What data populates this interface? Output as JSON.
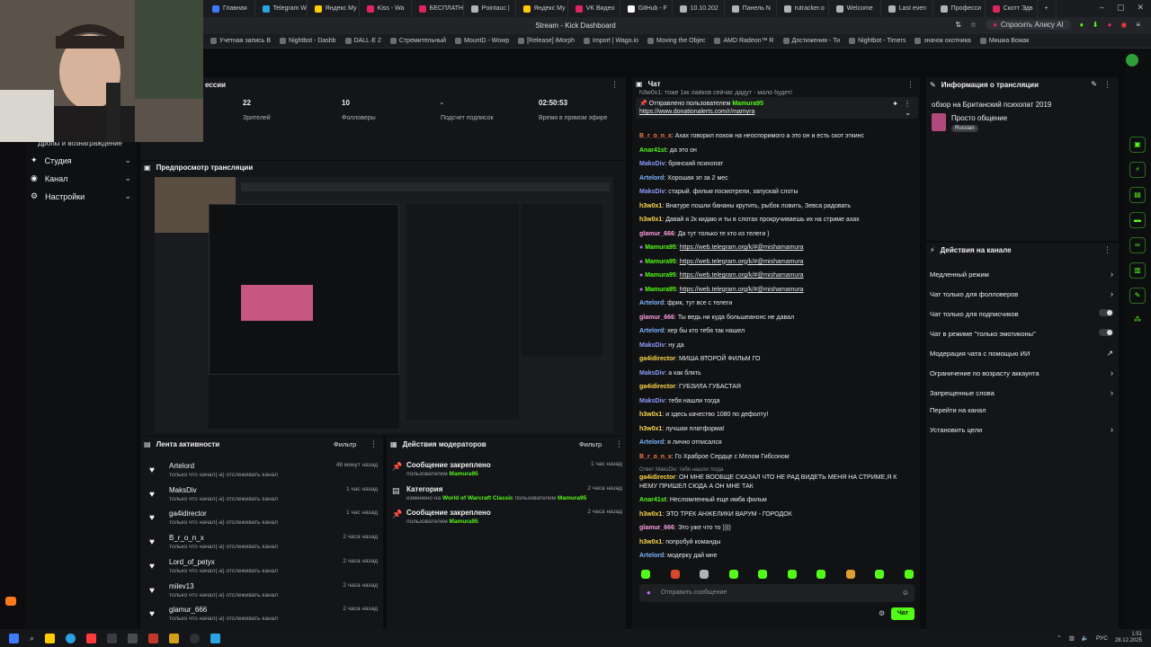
{
  "browser": {
    "tabs": [
      {
        "label": "Главная",
        "color": "#3d7bff"
      },
      {
        "label": "Telegram W",
        "color": "#2aa3e0"
      },
      {
        "label": "Яндекс Му",
        "color": "#ffcc00"
      },
      {
        "label": "Kiss - Wa",
        "color": "#e0245e"
      },
      {
        "label": "БЕСПЛАТН",
        "color": "#e0245e"
      },
      {
        "label": "Pointauc |",
        "color": "#b0b3b8"
      },
      {
        "label": "Яндекс Му",
        "color": "#ffcc00"
      },
      {
        "label": "VK Видео",
        "color": "#e0245e"
      },
      {
        "label": "GitHub - F",
        "color": "#ffffff"
      },
      {
        "label": "10.10.202",
        "color": "#b0b3b8"
      },
      {
        "label": "Панель N",
        "color": "#b0b3b8"
      },
      {
        "label": "rutracker.o",
        "color": "#b0b3b8"
      },
      {
        "label": "Welcome",
        "color": "#b0b3b8"
      },
      {
        "label": "Last even",
        "color": "#b0b3b8"
      },
      {
        "label": "Професси",
        "color": "#b0b3b8"
      },
      {
        "label": "Скотт Эдв",
        "color": "#e0245e"
      }
    ],
    "window_title": "Stream - Kick Dashboard",
    "alice_label": "Спросить Алису AI",
    "bookmarks": [
      "Учетная запись B",
      "Nightbot - Dashb",
      "DALL·E 2",
      "Стремительный",
      "MountD - Wowp",
      "[Release] iMorph",
      "Import | Wago.io",
      "Moving the Objec",
      "AMD Radeon™ R",
      "Достижения - Ти",
      "Nightbot - Timers",
      "значок охотника",
      "Мишка Вожак"
    ]
  },
  "nav": {
    "cut_label": "Дропы и вознаграждение",
    "items": [
      {
        "label": "Студия",
        "icon": "studio-icon"
      },
      {
        "label": "Канал",
        "icon": "channel-icon"
      },
      {
        "label": "Настройки",
        "icon": "settings-icon"
      }
    ]
  },
  "stats": {
    "section_label": "ессии",
    "items": [
      {
        "value": "22",
        "label": "Зрителей"
      },
      {
        "value": "10",
        "label": "Фолловеры"
      },
      {
        "value": "-",
        "label": "Подсчет подписок"
      },
      {
        "value": "02:50:53",
        "label": "Время в прямом эфире"
      }
    ]
  },
  "preview": {
    "title": "Предпросмотр трансляции"
  },
  "activity": {
    "title": "Лента активности",
    "filter": "Фильтр",
    "rows": [
      {
        "user": "Artelord",
        "sub": "только что начал(-а) отслеживать канал",
        "time": "48 минут назад"
      },
      {
        "user": "MaksDiv",
        "sub": "только что начал(-а) отслеживать канал",
        "time": "1 час назад"
      },
      {
        "user": "ga4idirector",
        "sub": "только что начал(-а) отслеживать канал",
        "time": "1 час назад"
      },
      {
        "user": "B_r_o_n_x",
        "sub": "только что начал(-а) отслеживать канал",
        "time": "2 часа назад"
      },
      {
        "user": "Lord_of_petyx",
        "sub": "только что начал(-а) отслеживать канал",
        "time": "2 часа назад"
      },
      {
        "user": "milev13",
        "sub": "только что начал(-а) отслеживать канал",
        "time": "2 часа назад"
      },
      {
        "user": "glamur_666",
        "sub": "только что начал(-а) отслеживать канал",
        "time": "2 часа назад"
      }
    ]
  },
  "modactions": {
    "title": "Действия модераторов",
    "filter": "Фильтр",
    "rows": [
      {
        "title": "Сообщение закреплено",
        "pre": "пользователем",
        "mid": "",
        "mid_label": "",
        "user": "Mamura95",
        "time": "1 час назад",
        "icon": "pin-icon"
      },
      {
        "title": "Категория",
        "pre": "изменено на",
        "mid": "World of Warcraft Classic",
        "mid_label": "пользователем",
        "user": "Mamura95",
        "time": "2 часа назад",
        "icon": "category-icon"
      },
      {
        "title": "Сообщение закреплено",
        "pre": "пользователем",
        "mid": "",
        "mid_label": "",
        "user": "Mamura95",
        "time": "2 часа назад",
        "icon": "pin-icon"
      }
    ]
  },
  "chat": {
    "title": "Чат",
    "top_cut": "h3w0x1: тоже 1кк лайков сейчас дадут - мало будет/",
    "pinned_by": "Отправлено пользователем",
    "pinned_user": "Mamura95",
    "pinned_link": "https://www.donationalerts.com/r/mamyra",
    "messages": [
      {
        "user": "B_r_o_n_x",
        "color": "#ff7a45",
        "text": "Ахах говорил похож на неоспоримого а это он и есть скот эткинс"
      },
      {
        "user": "Anar41st",
        "color": "#53fc18",
        "text": "да это он"
      },
      {
        "user": "MaksDiv",
        "color": "#8f9bff",
        "text": "брянский психопат"
      },
      {
        "user": "Artelord",
        "color": "#7fb6ff",
        "text": "Хорошая зп за 2 мес"
      },
      {
        "user": "MaksDiv",
        "color": "#8f9bff",
        "text": "старый. фильм посмотрели, запускай слоты"
      },
      {
        "user": "h3w0x1",
        "color": "#ffd84a",
        "text": "Внатуре пошли бананы крутить, рыбок ловить, Зевса радовать"
      },
      {
        "user": "h3w0x1",
        "color": "#ffd84a",
        "text": "Давай я 2к кидаю и ты в слотах прокручиваешь их на стриме ахах"
      },
      {
        "user": "glamur_666",
        "color": "#ff9de2",
        "text": "Да тут только те кто из телеги )"
      },
      {
        "user": "Mamura95",
        "color": "#53fc18",
        "text": "https://web.telegram.org/k/#@mishamamura",
        "link": true
      },
      {
        "user": "Mamura95",
        "color": "#53fc18",
        "text": "https://web.telegram.org/k/#@mishamamura",
        "link": true
      },
      {
        "user": "Mamura95",
        "color": "#53fc18",
        "text": "https://web.telegram.org/k/#@mishamamura",
        "link": true
      },
      {
        "user": "Mamura95",
        "color": "#53fc18",
        "text": "https://web.telegram.org/k/#@mishamamura",
        "link": true
      },
      {
        "user": "Artelord",
        "color": "#7fb6ff",
        "text": "фрик, тут все с телеги"
      },
      {
        "user": "glamur_666",
        "color": "#ff9de2",
        "text": "Ты ведь ни куда большеанонс не давал"
      },
      {
        "user": "Artelord",
        "color": "#7fb6ff",
        "text": "хер бы кто тебя так нашел"
      },
      {
        "user": "MaksDiv",
        "color": "#8f9bff",
        "text": "ну да"
      },
      {
        "user": "ga4idirector",
        "color": "#ffd84a",
        "text": "МИША ВТОРОЙ ФИЛЬМ ГО"
      },
      {
        "user": "MaksDiv",
        "color": "#8f9bff",
        "text": "а как блять"
      },
      {
        "user": "ga4idirector",
        "color": "#ffd84a",
        "text": "ГУБЗИЛА ГУБАСТАЯ"
      },
      {
        "user": "MaksDiv",
        "color": "#8f9bff",
        "text": "тебя нашли тогда"
      },
      {
        "user": "h3w0x1",
        "color": "#ffd84a",
        "text": "и здесь качество 1080 по дефолту!"
      },
      {
        "user": "h3w0x1",
        "color": "#ffd84a",
        "text": "лучшая платформа!"
      },
      {
        "user": "Artelord",
        "color": "#7fb6ff",
        "text": "я лично отписался"
      },
      {
        "user": "B_r_o_n_x",
        "color": "#ff7a45",
        "text": "Го Храброе Сердце с Мелом Гибсоном"
      }
    ],
    "reply_to": "Ответ MaksDiv: тебя нашли тогда",
    "reply_msg": {
      "user": "ga4idirector",
      "color": "#ffd84a",
      "text": "ОН МНЕ ВООБЩЕ СКАЗАЛ ЧТО НЕ РАД ВИДЕТЬ МЕНЯ НА СТРИМЕ,Я К НЕМУ ПРИШЕЛ СЮДА А ОН МНЕ ТАК"
    },
    "tail": [
      {
        "user": "Anar41st",
        "color": "#53fc18",
        "text": "Несломленный еще имба фильм"
      },
      {
        "user": "h3w0x1",
        "color": "#ffd84a",
        "text": "ЭТО ТРЕК АНЖЕЛИКИ ВАРУМ - ГОРОДОК"
      },
      {
        "user": "glamur_666",
        "color": "#ff9de2",
        "text": "Это уже что то ))))"
      },
      {
        "user": "h3w0x1",
        "color": "#ffd84a",
        "text": "попробуй команды"
      },
      {
        "user": "Artelord",
        "color": "#7fb6ff",
        "text": "модерку дай мне"
      }
    ],
    "input_placeholder": "Отправить сообщение",
    "send_label": "Чат"
  },
  "info": {
    "title": "Информация о трансляции",
    "stream_title": "обзор на Британский психопат 2019",
    "category": "Просто общение",
    "language": "Russian"
  },
  "channel_actions": {
    "title": "Действия на канале",
    "rows": [
      {
        "label": "Медленный режим",
        "control": "chevron"
      },
      {
        "label": "Чат только для фолловеров",
        "control": "chevron"
      },
      {
        "label": "Чат только для подписчиков",
        "control": "toggle"
      },
      {
        "label": "Чат в режиме \"только эмотиконы\"",
        "control": "toggle"
      },
      {
        "label": "Модерация чата с помощью ИИ",
        "control": "external"
      },
      {
        "label": "Ограничение по возрасту аккаунта",
        "control": "chevron"
      },
      {
        "label": "Запрещенные слова",
        "control": "chevron"
      },
      {
        "label": "Перейти на канал",
        "control": "none"
      },
      {
        "label": "Установить цели",
        "control": "chevron"
      }
    ]
  },
  "taskbar": {
    "lang": "РУС",
    "time": "1:51",
    "date": "28.12.2025"
  },
  "colors": {
    "accent": "#53fc18",
    "panel": "#141518",
    "background": "#0b0c0e"
  }
}
